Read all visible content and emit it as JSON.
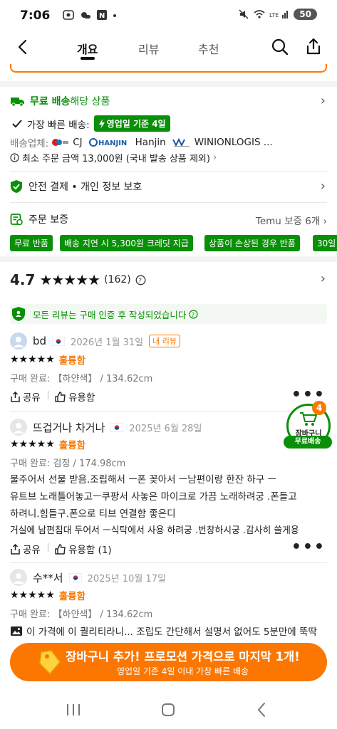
{
  "status_bar": {
    "time": "7:06",
    "battery": "50"
  },
  "nav": {
    "tabs": [
      {
        "label": "개요"
      },
      {
        "label": "리뷰"
      },
      {
        "label": "추천"
      }
    ]
  },
  "shipping": {
    "free_label": "무료 배송",
    "free_suffix": "해당 상품",
    "fastest_label": "가장 빠른 배송:",
    "fastest_badge": "영업일 기준 4일",
    "carrier_label": "배송업체:",
    "carriers": [
      "CJ",
      "Hanjin",
      "WINIONLOGIS ..."
    ],
    "min_order": "최소 주문 금액 13,000원 (국내 발송 상품 제외)"
  },
  "safety": {
    "label": "안전 결제 • 개인 정보 보호"
  },
  "guarantee": {
    "label": "주문 보증",
    "right_label": "Temu 보증 6개",
    "chips": [
      "무료 반품",
      "배송 지연 시 5,300원 크레딧 지급",
      "상품이 손상된 경우 반품",
      "30일"
    ]
  },
  "rating": {
    "score": "4.7",
    "count": "(162)"
  },
  "verified_notice": "모든 리뷰는 구매 인증 후 작성되었습니다",
  "reviews": [
    {
      "name": "bd",
      "date": "2026년 1월 31일",
      "badge": "내 리뷰",
      "grade": "훌륭함",
      "purchase": "구매 완료: 【하얀색】 / 134.62cm",
      "lines": [],
      "share": "공유",
      "helpful": "유용함"
    },
    {
      "name": "뜨겁거나 차거나",
      "date": "2025년 6월 28일",
      "grade": "훌륭함",
      "purchase": "구매 완료: 검정 / 174.98cm",
      "lines": [
        "물주어서 선물 받음.조립해서 ㅡ폰 꽂아서 ㅡ남편이랑 한잔 하구 ㅡ",
        "유트브 노래틀어놓고ㅡ쿠팡서 사놓은 마이크로 가끔 노래하려궁 .폰들고",
        "하려니.힘들구.폰으로 티브 연결함 좋은디",
        "거실에 남편침대 두어서 ㅡ식탁에서 사용 하려궁 .번창하시궁 .감사히 쓸게용"
      ],
      "share": "공유",
      "helpful": "유용함 (1)"
    },
    {
      "name": "수**서",
      "date": "2025년 10월 17일",
      "grade": "훌륭함",
      "purchase": "구매 완료: 【하얀색】 / 134.62cm",
      "lines": [
        "이 가격에 이 퀄리티라니... 조립도 간단해서 설명서 없어도 5분만에 뚝딱"
      ]
    }
  ],
  "cart_fab": {
    "count": "4",
    "label": "장바구니",
    "sublabel": "무료배송"
  },
  "cta": {
    "main": "장바구니 추가! 프로모션 가격으로 마지막 1개!",
    "sub": "영업일 기준 4일 이내 가장 빠른 배송"
  },
  "colors": {
    "accent": "#fb7701",
    "green": "#0a8f08"
  }
}
